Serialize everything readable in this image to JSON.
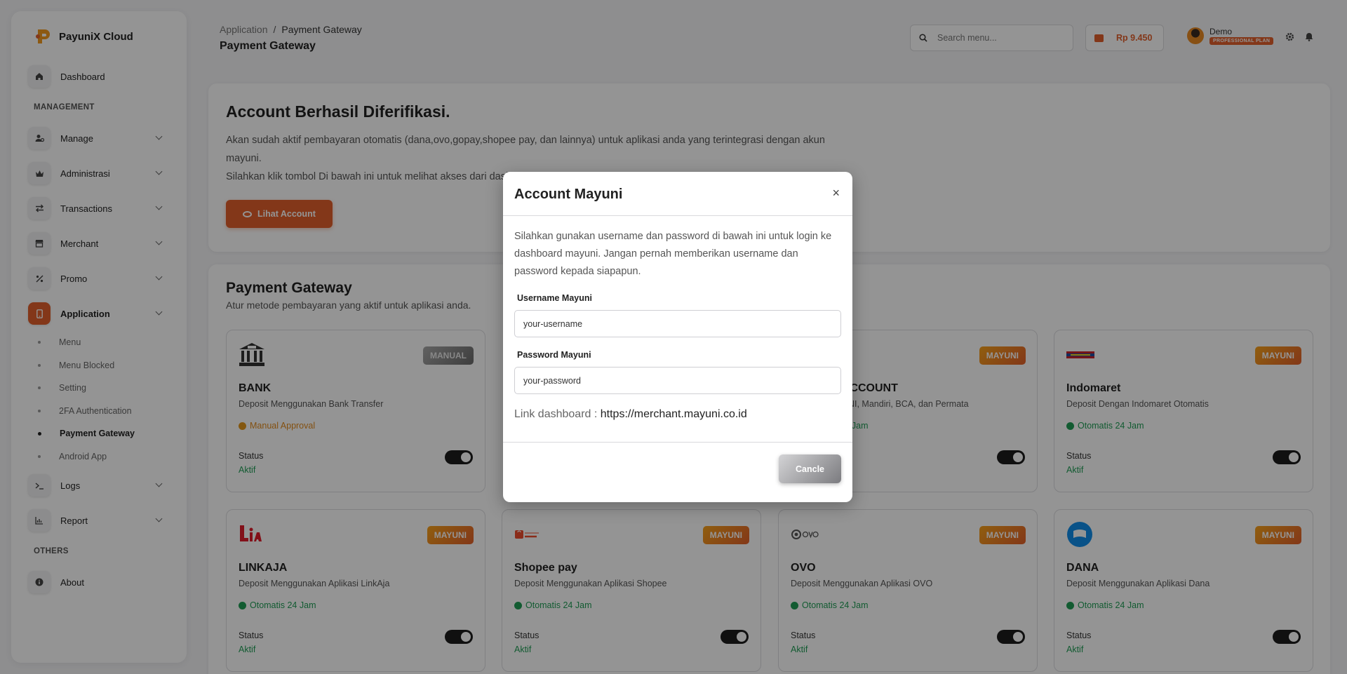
{
  "sidebar": {
    "brand": "PayuniX Cloud",
    "items": {
      "dashboard": "Dashboard",
      "manage": "Manage",
      "administrasi": "Administrasi",
      "transactions": "Transactions",
      "merchant": "Merchant",
      "promo": "Promo",
      "application": "Application",
      "logs": "Logs",
      "report": "Report",
      "about": "About"
    },
    "sections": {
      "management": "MANAGEMENT",
      "others": "OTHERS"
    },
    "application_sub": [
      "Menu",
      "Menu Blocked",
      "Setting",
      "2FA Authentication",
      "Payment Gateway",
      "Android App"
    ]
  },
  "header": {
    "breadcrumb_parent": "Application",
    "breadcrumb_sep": "/",
    "breadcrumb_current": "Payment Gateway",
    "title": "Payment Gateway",
    "search_placeholder": "Search menu...",
    "balance": "Rp 9.450",
    "user_name": "Demo",
    "user_plan": "PROFESSIONAL PLAN"
  },
  "verify": {
    "title": "Account Berhasil Diferifikasi.",
    "text1": "Akan sudah aktif pembayaran otomatis (dana,ovo,gopay,shopee pay, dan lainnya) untuk aplikasi anda yang terintegrasi dengan akun mayuni.",
    "text2": "Silahkan klik tombol Di bawah ini untuk melihat akses dari dashboard",
    "button": "Lihat Account"
  },
  "payment_gateway": {
    "title": "Payment Gateway",
    "subtitle": "Atur metode pembayaran yang aktif untuk aplikasi anda.",
    "status_label": "Status",
    "status_value": "Aktif",
    "cards": [
      {
        "name": "BANK",
        "desc": "Deposit Menggunakan Bank Transfer",
        "badge": "MANUAL",
        "mode": "Manual Approval"
      },
      {
        "name": "VIRTUAL ACCOUNT",
        "desc": "Deposit BRI, BNI, Mandiri, BCA, dan Permata",
        "badge": "MAYUNI",
        "mode": "Otomatis 24 Jam"
      },
      {
        "name": "Indomaret",
        "desc": "Deposit Dengan Indomaret Otomatis",
        "badge": "MAYUNI",
        "mode": "Otomatis 24 Jam"
      },
      {
        "name": "LINKAJA",
        "desc": "Deposit Menggunakan Aplikasi LinkAja",
        "badge": "MAYUNI",
        "mode": "Otomatis 24 Jam"
      },
      {
        "name": "Shopee pay",
        "desc": "Deposit Menggunakan Aplikasi Shopee",
        "badge": "MAYUNI",
        "mode": "Otomatis 24 Jam"
      },
      {
        "name": "OVO",
        "desc": "Deposit Menggunakan Aplikasi OVO",
        "badge": "MAYUNI",
        "mode": "Otomatis 24 Jam"
      },
      {
        "name": "DANA",
        "desc": "Deposit Menggunakan Aplikasi Dana",
        "badge": "MAYUNI",
        "mode": "Otomatis 24 Jam"
      }
    ]
  },
  "modal": {
    "title": "Account Mayuni",
    "close": "×",
    "description": "Silahkan gunakan username dan password di bawah ini untuk login ke dashboard mayuni. Jangan pernah memberikan username dan password kepada siapapun.",
    "username_label": "Username Mayuni",
    "username_value": "your-username",
    "password_label": "Password Mayuni",
    "password_value": "your-password",
    "link_label": "Link dashboard : ",
    "link_url": "https://merchant.mayuni.co.id",
    "cancel": "Cancle"
  },
  "colors": {
    "accent": "#e2602b",
    "success": "#1f9d55",
    "warning": "#e28a1d"
  },
  "icons": [
    "home-icon",
    "user-gear-icon",
    "crown-icon",
    "exchange-icon",
    "store-icon",
    "percent-icon",
    "mobile-icon",
    "terminal-icon",
    "chart-icon",
    "info-icon",
    "search-icon",
    "wallet-icon",
    "gear-icon",
    "bell-icon",
    "close-icon",
    "eye-icon"
  ]
}
